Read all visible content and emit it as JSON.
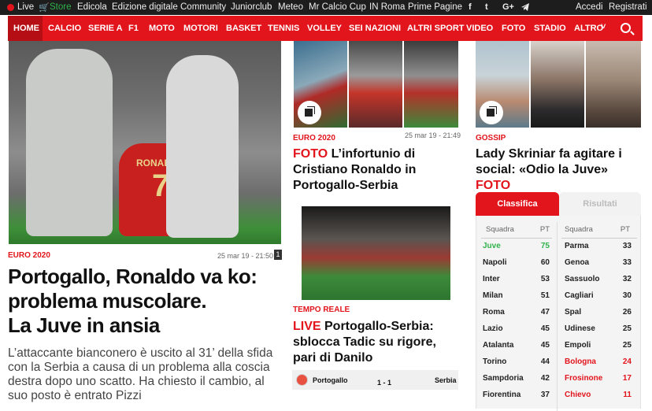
{
  "topbar": {
    "live": "Live",
    "store": "Store",
    "links": [
      "Edicola",
      "Edizione digitale",
      "Community",
      "Juniorclub",
      "Meteo",
      "Mr Calcio Cup",
      "IN Roma",
      "Prime Pagine"
    ],
    "social": [
      "f",
      "t",
      "G+",
      "telegram"
    ],
    "accedi": "Accedi",
    "registrati": "Registrati"
  },
  "nav": {
    "items": [
      "HOME",
      "CALCIO",
      "SERIE A",
      "F1",
      "MOTO",
      "MOTORI",
      "BASKET",
      "TENNIS",
      "VOLLEY",
      "SEI NAZIONI",
      "ALTRI SPORT",
      "VIDEO",
      "FOTO",
      "STADIO",
      "ALTRO"
    ],
    "altro_chevron": "˅"
  },
  "main": {
    "category": "EURO 2020",
    "date": "25 mar 19 - 21:50",
    "count": "1",
    "shirt_name": "RONALDO",
    "shirt_number": "7",
    "title_lines": [
      "Portogallo, Ronaldo va ko:",
      "problema muscolare.",
      "La Juve in ansia"
    ],
    "summary": "L’attaccante bianconero è uscito al 31’ della sfida con la Serbia a causa di un problema alla coscia destra dopo uno scatto. Ha chiesto il cambio, al suo posto è entrato Pizzi"
  },
  "mid1": {
    "category": "EURO 2020",
    "date": "25 mar 19 - 21:49",
    "prefix": "FOTO",
    "title_rest": " L’infortunio di Cristiano Ronaldo in Portogallo-Serbia"
  },
  "mid2": {
    "category": "TEMPO REALE",
    "prefix": "LIVE",
    "title_rest": " Portogallo-Serbia: sblocca Tadic su rigore, pari di Danilo",
    "home": "Portogallo",
    "score": "1 - 1",
    "away": "Serbia"
  },
  "right1": {
    "category": "GOSSIP",
    "title": "Lady Skriniar fa agitare i social: «Odio la Juve»",
    "suffix": "FOTO"
  },
  "standings": {
    "tab_active": "Classifica",
    "tab_inactive": "Risultati",
    "col_team": "Squadra",
    "col_pt": "PT",
    "left": [
      {
        "team": "Juve",
        "pt": "75"
      },
      {
        "team": "Napoli",
        "pt": "60"
      },
      {
        "team": "Inter",
        "pt": "53"
      },
      {
        "team": "Milan",
        "pt": "51"
      },
      {
        "team": "Roma",
        "pt": "47"
      },
      {
        "team": "Lazio",
        "pt": "45"
      },
      {
        "team": "Atalanta",
        "pt": "45"
      },
      {
        "team": "Torino",
        "pt": "44"
      },
      {
        "team": "Sampdoria",
        "pt": "42"
      },
      {
        "team": "Fiorentina",
        "pt": "37"
      }
    ],
    "right": [
      {
        "team": "Parma",
        "pt": "33"
      },
      {
        "team": "Genoa",
        "pt": "33"
      },
      {
        "team": "Sassuolo",
        "pt": "32"
      },
      {
        "team": "Cagliari",
        "pt": "30"
      },
      {
        "team": "Spal",
        "pt": "26"
      },
      {
        "team": "Udinese",
        "pt": "25"
      },
      {
        "team": "Empoli",
        "pt": "25"
      },
      {
        "team": "Bologna",
        "pt": "24"
      },
      {
        "team": "Frosinone",
        "pt": "17"
      },
      {
        "team": "Chievo",
        "pt": "11"
      }
    ],
    "colors": {
      "leader": "#2fb24a",
      "relegation": "#e2141c"
    }
  }
}
